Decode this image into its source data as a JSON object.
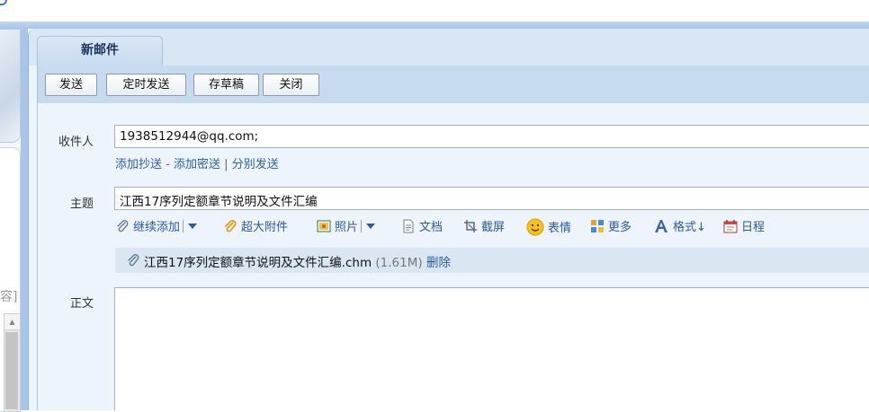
{
  "tab": {
    "title": "新邮件"
  },
  "toolbar": {
    "send": "发送",
    "scheduled_send": "定时发送",
    "save_draft": "存草稿",
    "close": "关闭"
  },
  "fields": {
    "to_label": "收件人",
    "to_value": "1938512944@qq.com;",
    "add_cc": "添加抄送",
    "dash": "-",
    "add_bcc": "添加密送",
    "pipe": "|",
    "separate_send": "分别发送",
    "subject_label": "主题",
    "subject_value": "江西17序列定额章节说明及文件汇编",
    "body_label": "正文"
  },
  "attach_toolbar": {
    "continue_add": "继续添加",
    "large_attachment": "超大附件",
    "photo": "照片",
    "document": "文档",
    "screenshot": "截屏",
    "emoji": "表情",
    "more": "更多",
    "format": "格式↓",
    "calendar": "日程"
  },
  "attachment": {
    "filename": "江西17序列定额章节说明及文件汇编.chm",
    "size": "(1.61M)",
    "delete": "删除"
  },
  "left_pane": {
    "partial_text": "容]"
  },
  "icons": [
    "paperclip-icon",
    "pencil-clip-icon",
    "photo-icon",
    "document-icon",
    "screenshot-icon",
    "emoji-icon",
    "more-icon",
    "format-icon",
    "calendar-icon",
    "scroll-up-icon"
  ],
  "colors": {
    "link": "#2d5aa0",
    "toolbar_bg": "#c6daf0",
    "tab_bg": "#c8dbf0",
    "attach_row_bg": "#dbe6f3"
  }
}
